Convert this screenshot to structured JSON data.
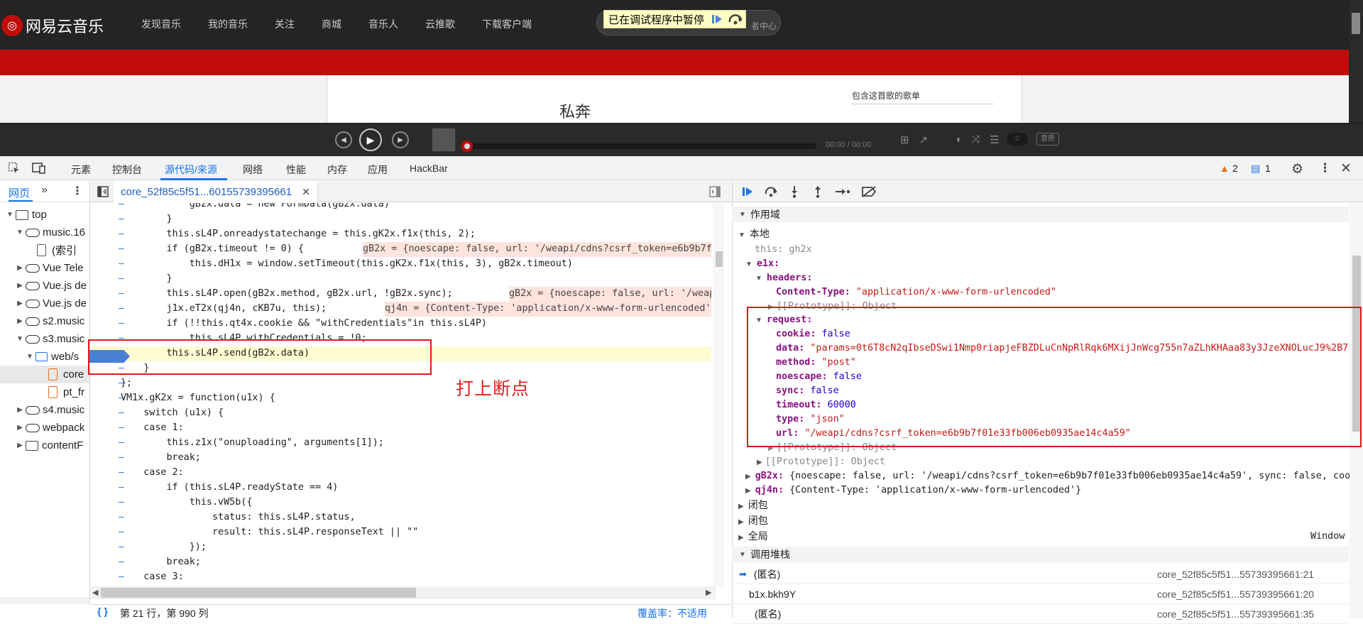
{
  "site": {
    "logo_text": "网易云音乐",
    "nav": [
      "发现音乐",
      "我的音乐",
      "关注",
      "商城",
      "音乐人",
      "云推歌",
      "下载客户端"
    ],
    "paused_banner": "已在调试程序中暂停",
    "creator_center_partial": "者中心",
    "song_title": "私奔",
    "side_title": "包含这首歌的歌单",
    "player_time": "00:00 / 00:00",
    "player_count": "0",
    "player_quality": "音质"
  },
  "devtools": {
    "tabs": [
      "元素",
      "控制台",
      "源代码/来源",
      "网络",
      "性能",
      "内存",
      "应用",
      "HackBar"
    ],
    "active_tab": "源代码/来源",
    "warnings_count": "2",
    "messages_count": "1",
    "nav_tab": "网页",
    "file_tab": "core_52f85c5f51...60155739395661",
    "tree": [
      {
        "label": "top",
        "indent": 0
      },
      {
        "label": "music.16",
        "indent": 1
      },
      {
        "label": "(索引",
        "indent": 2
      },
      {
        "label": "Vue Tele",
        "indent": 1
      },
      {
        "label": "Vue.js de",
        "indent": 1
      },
      {
        "label": "Vue.js de",
        "indent": 1
      },
      {
        "label": "s2.music",
        "indent": 1
      },
      {
        "label": "s3.music",
        "indent": 1
      },
      {
        "label": "web/s",
        "indent": 2
      },
      {
        "label": "core",
        "indent": 3
      },
      {
        "label": "pt_fr",
        "indent": 3
      },
      {
        "label": "s4.music",
        "indent": 1
      },
      {
        "label": "webpack",
        "indent": 1
      },
      {
        "label": "contentF",
        "indent": 1
      }
    ],
    "code_lines": [
      "            gB2x.data = new FormData(gB2x.data)",
      "        }",
      "        this.sL4P.onreadystatechange = this.gK2x.f1x(this, 2);",
      "        if (gB2x.timeout != 0) {",
      "            this.dH1x = window.setTimeout(this.gK2x.f1x(this, 3), gB2x.timeout)",
      "        }",
      "        this.sL4P.open(gB2x.method, gB2x.url, !gB2x.sync);",
      "        j1x.eT2x(qj4n, cKB7u, this);",
      "        if (!!this.qt4x.cookie && \"withCredentials\"in this.sL4P)",
      "            this.sL4P.withCredentials = !0;",
      "        this.sL4P.send(gB2x.data)",
      "    }",
      "};",
      "VM1x.gK2x = function(u1x) {",
      "    switch (u1x) {",
      "    case 1:",
      "        this.z1x(\"onuploading\", arguments[1]);",
      "        break;",
      "    case 2:",
      "        if (this.sL4P.readyState == 4)",
      "            this.vW5b({",
      "                status: this.sL4P.status,",
      "                result: this.sL4P.responseText || \"\"",
      "            });",
      "        break;",
      "    case 3:"
    ],
    "inline_values": [
      {
        "line": 3,
        "text": "gB2x = {noescape: false, url: '/weapi/cdns?csrf_token=e6b9b7f0"
      },
      {
        "line": 6,
        "text": "gB2x = {noescape: false, url: '/weap"
      },
      {
        "line": 7,
        "text": "qj4n = {Content-Type: 'application/x-www-form-urlencoded'}"
      }
    ],
    "status_bar": "第 21 行，第 990 列",
    "coverage": "覆盖率：不适用",
    "annotation": "打上断点"
  },
  "scope": {
    "header": "作用域",
    "local_label": "本地",
    "this_row": "this: gh2x",
    "e1x_key": "e1x:",
    "headers_key": "headers:",
    "content_type_key": "Content-Type:",
    "content_type_val": "\"application/x-www-form-urlencoded\"",
    "prototype_row": "[[Prototype]]: Object",
    "request_key": "request:",
    "request_fields": [
      {
        "key": "cookie:",
        "val": "false",
        "kind": "nv"
      },
      {
        "key": "data:",
        "val": "\"params=0t6T8cN2qIbseDSwi1Nmp0riapjeFBZDLuCnNpRlRqk6MXijJnWcg755n7aZLhKHAaa83y3JzeXNOLucJ9%2B7:",
        "kind": "sv"
      },
      {
        "key": "method:",
        "val": "\"post\"",
        "kind": "sv"
      },
      {
        "key": "noescape:",
        "val": "false",
        "kind": "nv"
      },
      {
        "key": "sync:",
        "val": "false",
        "kind": "nv"
      },
      {
        "key": "timeout:",
        "val": "60000",
        "kind": "nv"
      },
      {
        "key": "type:",
        "val": "\"json\"",
        "kind": "sv"
      },
      {
        "key": "url:",
        "val": "\"/weapi/cdns?csrf_token=e6b9b7f01e33fb006eb0935ae14c4a59\"",
        "kind": "sv"
      }
    ],
    "prototype_row2": "[[Prototype]]: Object",
    "prototype_row3": "[[Prototype]]: Object",
    "gb2x_row_key": "gB2x:",
    "gb2x_row_val": "{noescape: false, url: '/weapi/cdns?csrf_token=e6b9b7f01e33fb006eb0935ae14c4a59', sync: false, coo",
    "qj4n_row_key": "qj4n:",
    "qj4n_row_val": "{Content-Type: 'application/x-www-form-urlencoded'}",
    "closure1": "闭包",
    "closure2": "闭包",
    "global": "全局",
    "global_val": "Window"
  },
  "callstack": {
    "header": "调用堆栈",
    "frames": [
      {
        "name": "(匿名)",
        "loc": "core_52f85c5f51...55739395661:21"
      },
      {
        "name": "b1x.bkh9Y",
        "loc": "core_52f85c5f51...55739395661:20"
      },
      {
        "name": "(匿名)",
        "loc": "core_52f85c5f51...55739395661:35"
      }
    ]
  }
}
